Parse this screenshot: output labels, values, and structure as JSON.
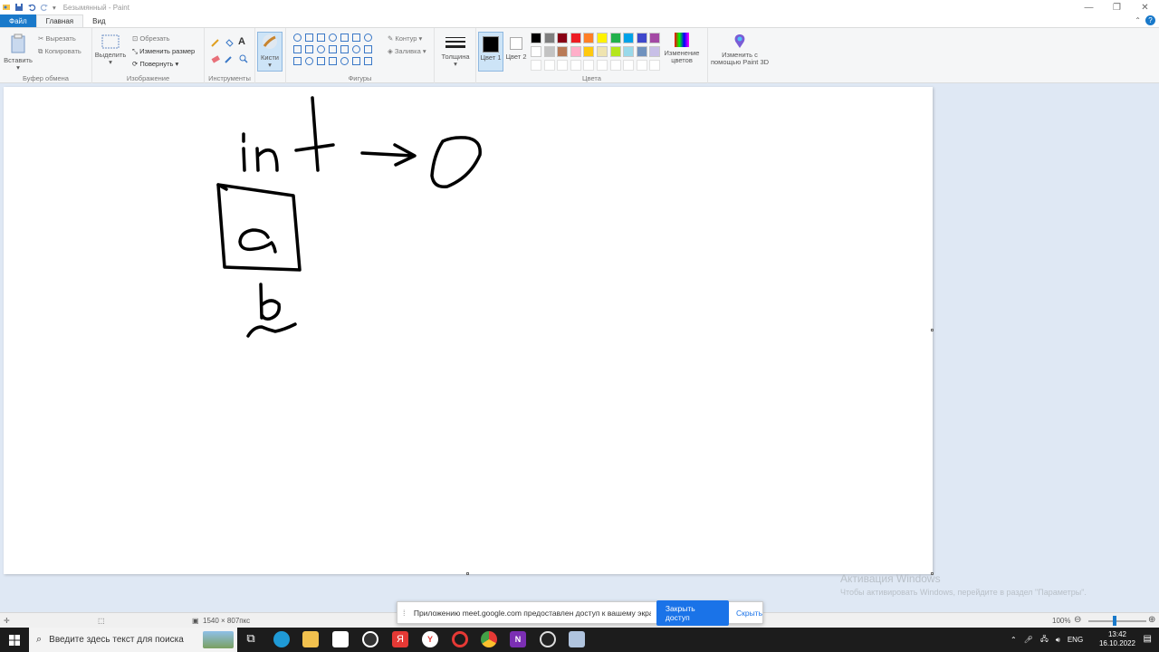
{
  "window": {
    "title": "Безымянный - Paint"
  },
  "menu": {
    "file": "Файл",
    "home": "Главная",
    "view": "Вид"
  },
  "clipboard": {
    "paste": "Вставить",
    "cut": "Вырезать",
    "copy": "Копировать",
    "label": "Буфер обмена"
  },
  "image": {
    "select": "Выделить",
    "crop": "Обрезать",
    "resize": "Изменить размер",
    "rotate": "Повернуть",
    "label": "Изображение"
  },
  "tools": {
    "label": "Инструменты"
  },
  "brushes": {
    "label": "Кисти"
  },
  "shapes": {
    "outline": "Контур",
    "fill": "Заливка",
    "label": "Фигуры"
  },
  "size": {
    "label": "Толщина"
  },
  "colors": {
    "color1": "Цвет 1",
    "color2": "Цвет 2",
    "edit": "Изменение цветов",
    "label": "Цвета",
    "color1_value": "#000000",
    "color2_value": "#ffffff",
    "palette": [
      "#000000",
      "#7f7f7f",
      "#880015",
      "#ed1c24",
      "#ff7f27",
      "#fff200",
      "#22b14c",
      "#00a2e8",
      "#3f48cc",
      "#a349a4",
      "#ffffff",
      "#c3c3c3",
      "#b97a57",
      "#ffaec9",
      "#ffc90e",
      "#efe4b0",
      "#b5e61d",
      "#99d9ea",
      "#7092be",
      "#c8bfe7"
    ]
  },
  "paint3d": {
    "label": "Изменить с помощью Paint 3D"
  },
  "status": {
    "size": "1540 × 807пкс",
    "zoom": "100%"
  },
  "activation": {
    "title": "Активация Windows",
    "subtitle": "Чтобы активировать Windows, перейдите в раздел \"Параметры\"."
  },
  "notification": {
    "message": "Приложению meet.google.com предоставлен доступ к вашему экрану.",
    "stop_button": "Закрыть доступ",
    "hide_button": "Скрыть"
  },
  "taskbar": {
    "search_placeholder": "Введите здесь текст для поиска",
    "language": "ENG",
    "time": "13:42",
    "date": "16.10.2022"
  }
}
